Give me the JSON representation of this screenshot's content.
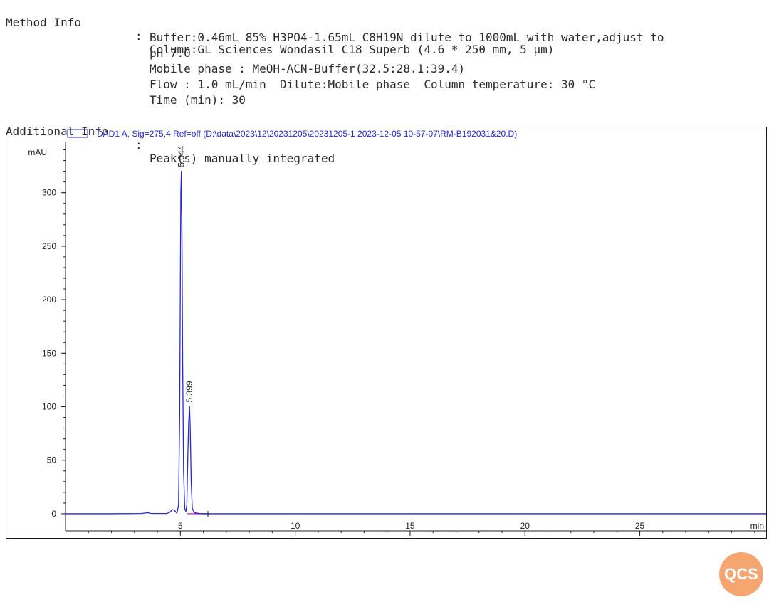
{
  "method": {
    "label": "Method Info",
    "colon": ":",
    "lines": [
      "Column:GL Sciences Wondasil C18 Superb (4.6 * 250 mm, 5 μm)",
      "Buffer:0.46mL 85% H3PO4-1.65mL C8H19N dilute to 1000mL with water,adjust to",
      "pH 7.0",
      "Mobile phase : MeOH-ACN-Buffer(32.5:28.1:39.4)",
      "Flow : 1.0 mL/min  Dilute:Mobile phase  Column temperature: 30 °C",
      "Time (min): 30"
    ]
  },
  "additional": {
    "label": "Additional Info",
    "colon": ":",
    "value": "Peak(s) manually integrated"
  },
  "colors": {
    "trace": "#2626d9",
    "legend_text": "#2626d9",
    "baseline_marker": "#d63cb4",
    "axis": "#222222",
    "logo": "#f5a56f"
  },
  "logo_text": "QCS",
  "chart_data": {
    "type": "line",
    "legend": "DAD1 A, Sig=275,4 Ref=off (D:\\data\\2023\\12\\20231205\\20231205-1 2023-12-05 10-57-07\\RM-B192031&20.D)",
    "ylabel": "mAU",
    "xlabel": "min",
    "xlim": [
      0,
      30.5
    ],
    "ylim": [
      -16,
      345
    ],
    "x_ticks": [
      5,
      10,
      15,
      20,
      25
    ],
    "y_ticks": [
      0,
      50,
      100,
      150,
      200,
      250,
      300
    ],
    "x_minor_step": 1,
    "y_minor_step": 10,
    "series": [
      {
        "x": [
          0,
          2.0,
          3.3,
          3.5,
          3.6,
          3.7,
          4.4,
          4.55,
          4.65,
          4.75,
          4.85,
          4.92,
          4.97,
          5.0,
          5.02,
          5.044,
          5.07,
          5.1,
          5.14,
          5.19,
          5.24,
          5.28,
          5.32,
          5.36,
          5.399,
          5.43,
          5.47,
          5.52,
          5.6,
          5.8,
          6.0,
          6.5,
          8,
          10,
          15,
          20,
          25,
          30.5
        ],
        "y": [
          0,
          0,
          0.2,
          0.8,
          1.0,
          0.3,
          0.2,
          1.5,
          4.0,
          3.0,
          0.5,
          8,
          90,
          220,
          300,
          320,
          260,
          140,
          40,
          5,
          2,
          8,
          50,
          85,
          100,
          80,
          30,
          5,
          1,
          0.3,
          0,
          0,
          0,
          0,
          0,
          0,
          0,
          0
        ]
      }
    ],
    "peak_labels": [
      {
        "x": 5.044,
        "y": 320,
        "text": "5.044"
      },
      {
        "x": 5.399,
        "y": 100,
        "text": "5.399"
      }
    ],
    "integration_baseline": {
      "x": [
        5.3,
        6.2
      ],
      "y": [
        0,
        0
      ]
    }
  }
}
